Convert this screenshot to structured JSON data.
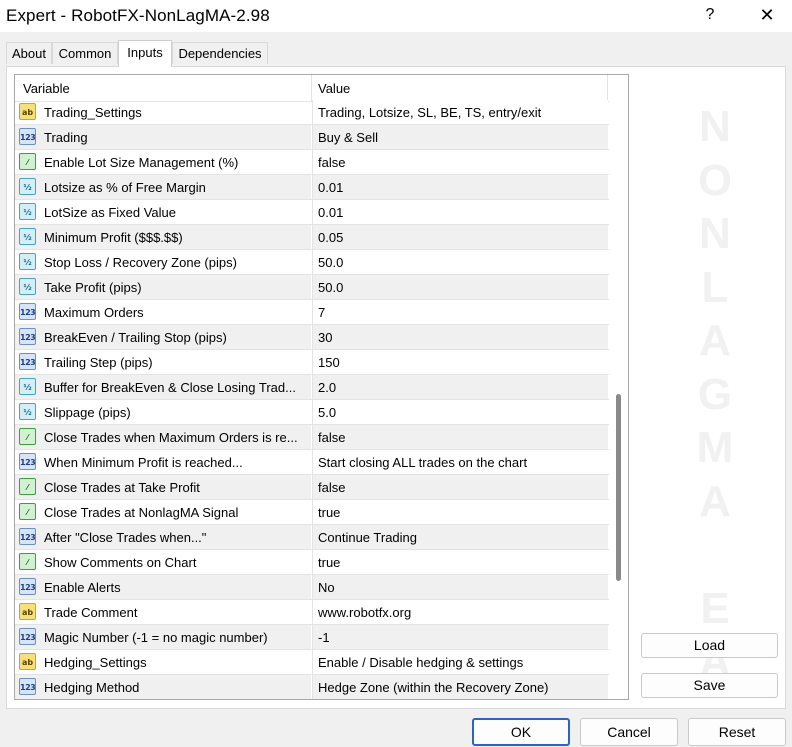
{
  "window": {
    "title": "Expert - RobotFX-NonLagMA-2.98",
    "help": "?",
    "close": "✕"
  },
  "tabs": [
    {
      "label": "About"
    },
    {
      "label": "Common"
    },
    {
      "label": "Inputs"
    },
    {
      "label": "Dependencies"
    }
  ],
  "grid": {
    "headers": {
      "variable": "Variable",
      "value": "Value"
    },
    "rows": [
      {
        "type": "ab",
        "name": "Trading_Settings",
        "value": "Trading, Lotsize, SL, BE, TS, entry/exit"
      },
      {
        "type": "123",
        "name": "Trading",
        "value": "Buy & Sell"
      },
      {
        "type": "bool",
        "name": "Enable Lot Size Management (%)",
        "value": "false"
      },
      {
        "type": "dbl",
        "name": "Lotsize as % of Free Margin",
        "value": "0.01"
      },
      {
        "type": "dbl",
        "name": "LotSize as Fixed Value",
        "value": "0.01"
      },
      {
        "type": "dbl",
        "name": "Minimum Profit ($$$.$$)",
        "value": "0.05"
      },
      {
        "type": "dbl",
        "name": "Stop Loss / Recovery Zone (pips)",
        "value": "50.0"
      },
      {
        "type": "dbl",
        "name": "Take Profit (pips)",
        "value": "50.0"
      },
      {
        "type": "123",
        "name": "Maximum Orders",
        "value": "7"
      },
      {
        "type": "123",
        "name": "BreakEven / Trailing Stop (pips)",
        "value": "30"
      },
      {
        "type": "123",
        "name": "Trailing Step (pips)",
        "value": "150"
      },
      {
        "type": "dbl",
        "name": "Buffer for BreakEven & Close Losing Trad...",
        "value": "2.0"
      },
      {
        "type": "dbl",
        "name": "Slippage (pips)",
        "value": "5.0"
      },
      {
        "type": "bool",
        "name": "Close Trades when Maximum Orders is re...",
        "value": "false"
      },
      {
        "type": "123",
        "name": "When Minimum Profit is reached...",
        "value": "Start closing ALL trades on the chart"
      },
      {
        "type": "bool",
        "name": "Close Trades at Take Profit",
        "value": "false"
      },
      {
        "type": "bool",
        "name": "Close Trades at NonlagMA Signal",
        "value": "true"
      },
      {
        "type": "123",
        "name": "After \"Close Trades when...\"",
        "value": "Continue Trading"
      },
      {
        "type": "bool",
        "name": "Show Comments on Chart",
        "value": "true"
      },
      {
        "type": "123",
        "name": "Enable Alerts",
        "value": "No"
      },
      {
        "type": "ab",
        "name": "Trade Comment",
        "value": "www.robotfx.org"
      },
      {
        "type": "123",
        "name": "Magic Number (-1 = no magic number)",
        "value": "-1"
      },
      {
        "type": "ab",
        "name": "Hedging_Settings",
        "value": "Enable / Disable hedging & settings"
      },
      {
        "type": "123",
        "name": "Hedging Method",
        "value": "Hedge Zone (within the Recovery Zone)"
      }
    ]
  },
  "icons": {
    "ab": "ab",
    "123": "123",
    "bool": "⁄",
    "dbl": "½"
  },
  "watermark": [
    "N",
    "O",
    "N",
    "L",
    "A",
    "G",
    "M",
    "A",
    "",
    "E",
    "A"
  ],
  "side_buttons": {
    "load": "Load",
    "save": "Save"
  },
  "bottom_buttons": {
    "ok": "OK",
    "cancel": "Cancel",
    "reset": "Reset"
  }
}
